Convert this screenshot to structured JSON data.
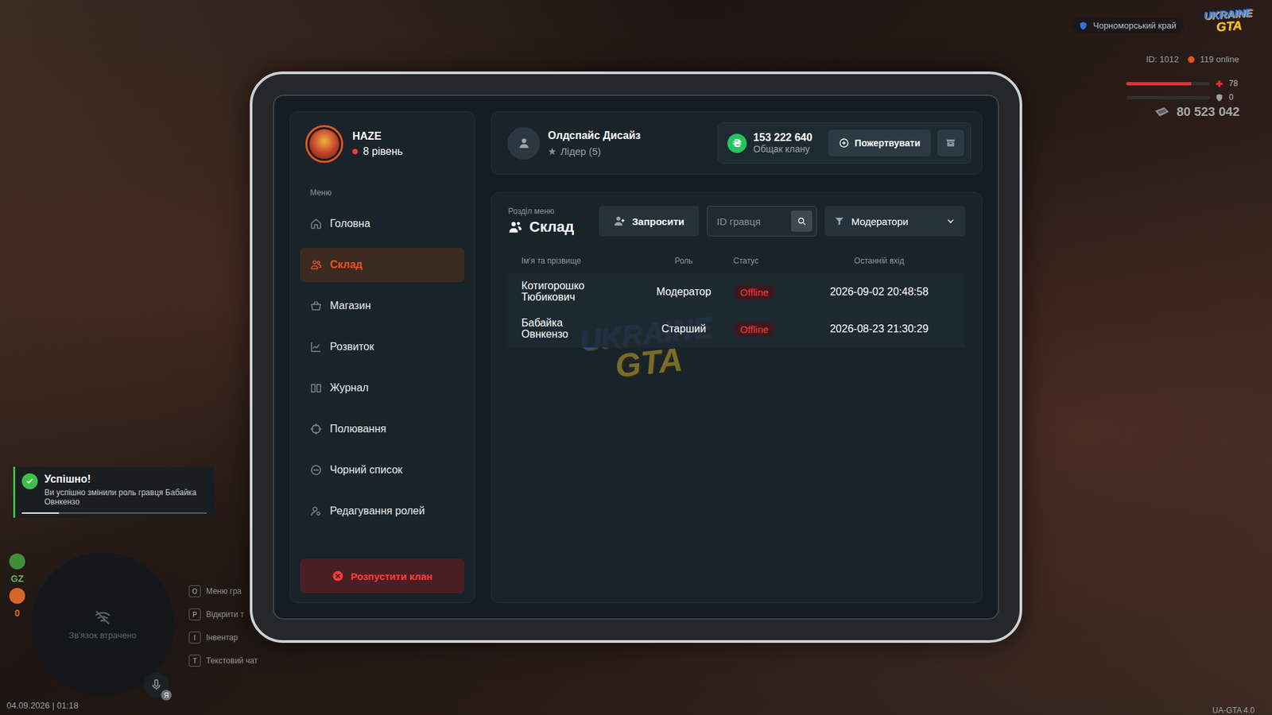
{
  "hud": {
    "location": "Чорноморський край",
    "logo": {
      "top": "UKRAINE",
      "bottom": "GTA"
    },
    "player_id": "ID: 1012",
    "online": "119 online",
    "health": {
      "value": "78",
      "level": 0.78
    },
    "armor": {
      "value": "0",
      "level": 0
    },
    "money": "80 523 042",
    "datetime": "04.09.2026 | 01:18",
    "version": "UA-GTA 4.0",
    "minimap": {
      "text": "Зв'язок втрачено",
      "voice_key": "Я"
    },
    "zone": {
      "label": "GZ",
      "wanted": "0"
    },
    "hotkeys": [
      {
        "key": "O",
        "label": "Меню гра"
      },
      {
        "key": "P",
        "label": "Відкрити т"
      },
      {
        "key": "I",
        "label": "Інвентар"
      },
      {
        "key": "T",
        "label": "Текстовий чат"
      }
    ]
  },
  "notification": {
    "title": "Успішно!",
    "message": "Ви успішно змінили роль гравця Бабайка Овнкензо",
    "level": 0.2
  },
  "tablet": {
    "profile": {
      "name": "HAZE",
      "level": "8 рівень"
    },
    "sidebar": {
      "heading": "Меню",
      "items": [
        {
          "label": "Головна",
          "selected": false
        },
        {
          "label": "Склад",
          "selected": true
        },
        {
          "label": "Магазин",
          "selected": false
        },
        {
          "label": "Розвиток",
          "selected": false
        },
        {
          "label": "Журнал",
          "selected": false
        },
        {
          "label": "Полювання",
          "selected": false
        },
        {
          "label": "Чорний список",
          "selected": false
        },
        {
          "label": "Редагування ролей",
          "selected": false
        }
      ],
      "disband": "Розпустити клан"
    },
    "leader": {
      "name": "Олдспайс Дисайз",
      "rank": "Лідер (5)"
    },
    "treasury": {
      "currency": "₴",
      "amount": "153 222 640",
      "label": "Общак клану",
      "donate": "Пожертвувати"
    },
    "section": {
      "caption": "Розділ меню",
      "title": "Склад"
    },
    "invite": "Запросити",
    "search": {
      "placeholder": "ID гравця"
    },
    "filter": {
      "value": "Модератори"
    },
    "table": {
      "columns": [
        "Ім'я та прізвище",
        "Роль",
        "Статус",
        "Останній вхід"
      ],
      "rows": [
        {
          "name": "Котигорошко Тюбикович",
          "role": "Модератор",
          "status": "Offline",
          "online": false,
          "last_login": "2026-09-02 20:48:58"
        },
        {
          "name": "Бабайка Овнкензо",
          "role": "Старший",
          "status": "Offline",
          "online": false,
          "last_login": "2026-08-23 21:30:29"
        }
      ]
    },
    "watermark": {
      "top": "UKRAINE",
      "bottom": "GTA"
    }
  }
}
